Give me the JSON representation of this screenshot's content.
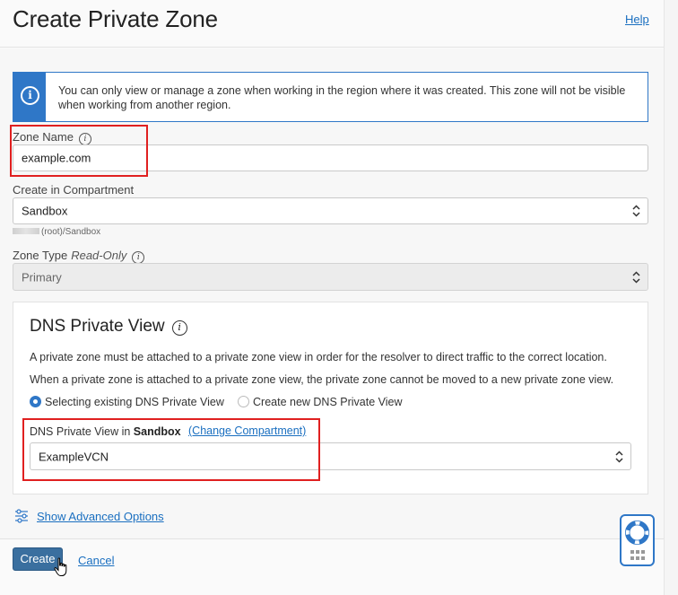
{
  "header": {
    "title": "Create Private Zone",
    "help_label": "Help"
  },
  "info_banner": {
    "icon": "info-icon",
    "text": "You can only view or manage a zone when working in the region where it was created. This zone will not be visible when working from another region."
  },
  "zone_name": {
    "label": "Zone Name",
    "value": "example.com"
  },
  "compartment": {
    "label": "Create in Compartment",
    "selected": "Sandbox",
    "path_hint": "(root)/Sandbox"
  },
  "zone_type": {
    "label": "Zone Type",
    "readonly_note": "Read-Only",
    "selected": "Primary"
  },
  "dns_private_view": {
    "title": "DNS Private View",
    "desc1": "A private zone must be attached to a private zone view in order for the resolver to direct traffic to the correct location.",
    "desc2": "When a private zone is attached to a private zone view, the private zone cannot be moved to a new private zone view.",
    "radio_existing": "Selecting existing DNS Private View",
    "radio_new": "Create new DNS Private View",
    "selected_option": "existing",
    "view_label_prefix": "DNS Private View in",
    "view_label_compartment": "Sandbox",
    "change_compartment": "(Change Compartment)",
    "selected_view": "ExampleVCN"
  },
  "advanced": {
    "label": "Show Advanced Options"
  },
  "footer": {
    "create_label": "Create",
    "cancel_label": "Cancel"
  },
  "colors": {
    "accent": "#2f77c7",
    "link": "#1a6fc0",
    "primary_button": "#3a6f9f",
    "highlight_box": "#e02020"
  }
}
